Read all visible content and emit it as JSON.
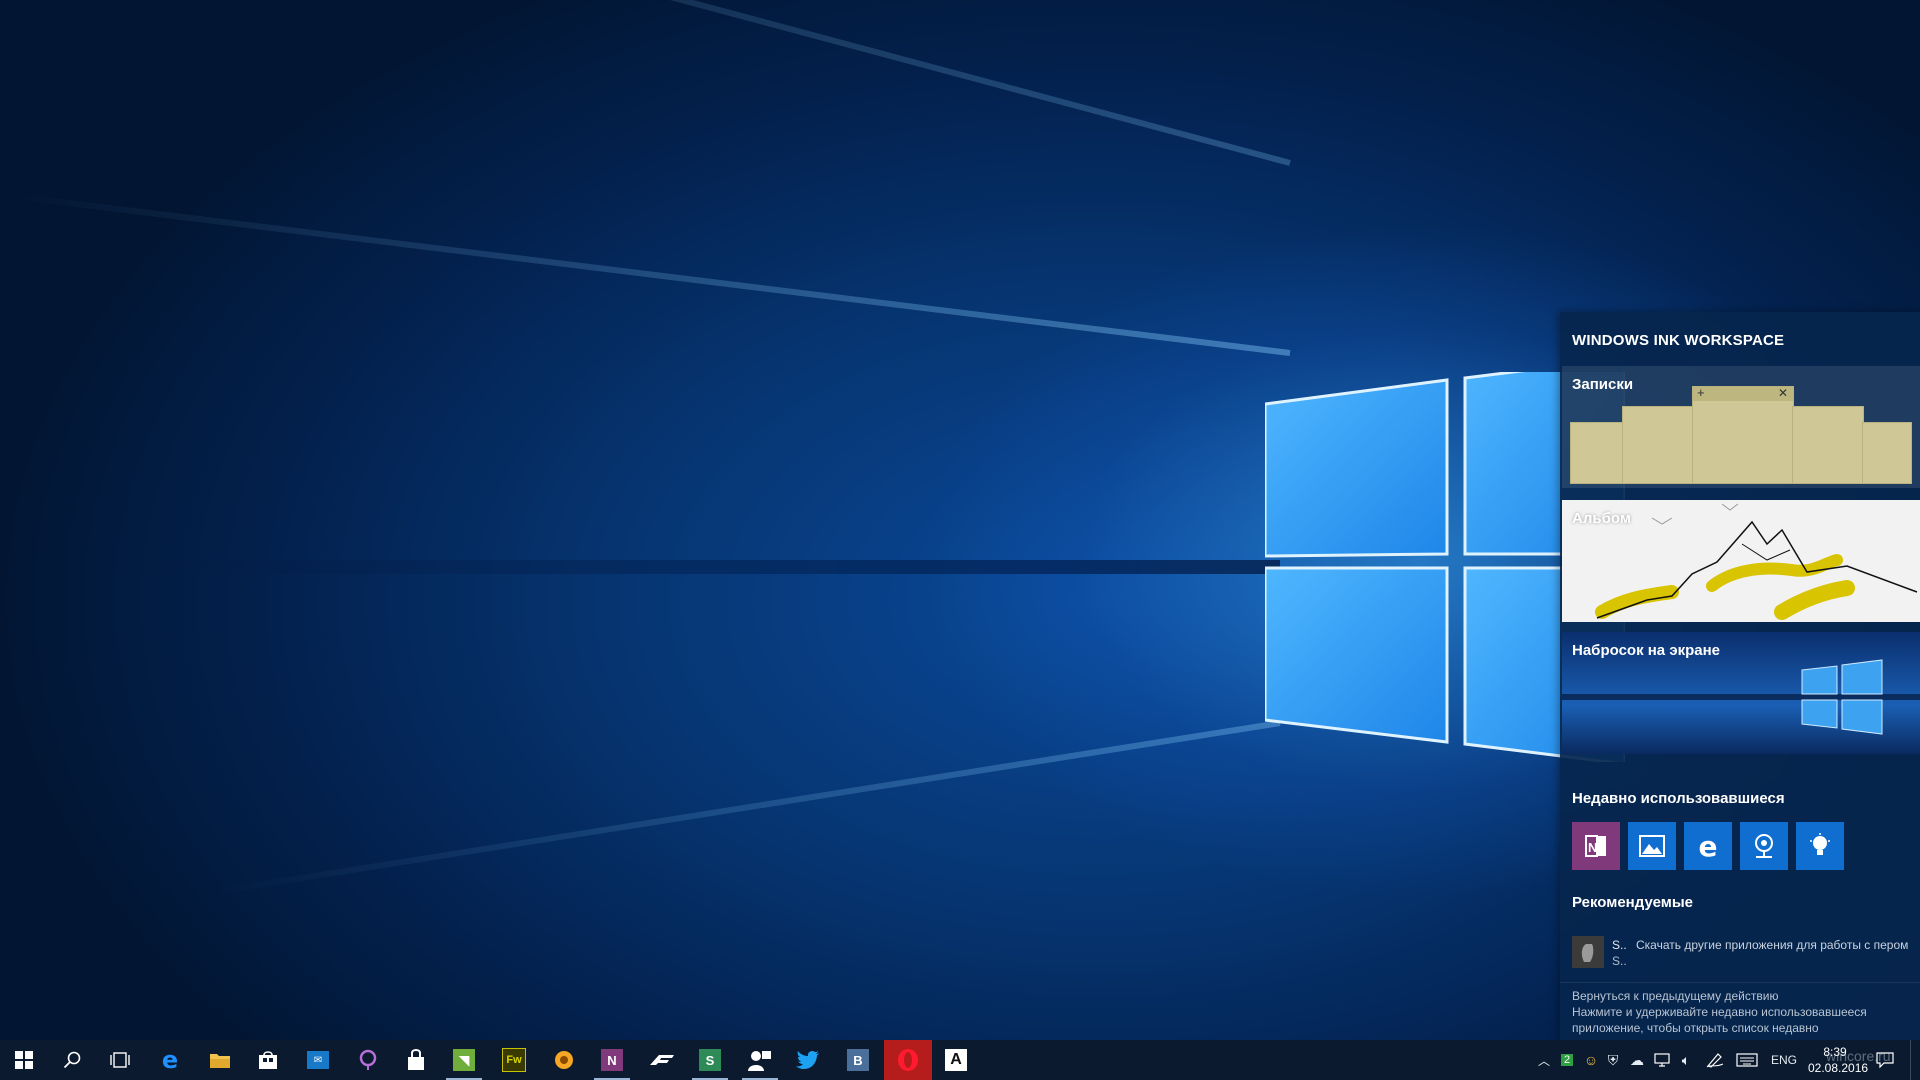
{
  "ink_workspace": {
    "title": "WINDOWS INK WORKSPACE",
    "tiles": [
      {
        "label": "Записки"
      },
      {
        "label": "Альбом"
      },
      {
        "label": "Набросок на экране"
      }
    ],
    "recent_title": "Недавно использовавшиеся",
    "recent_apps": [
      {
        "icon": "onenote-icon",
        "color": "#80397b"
      },
      {
        "icon": "photos-icon",
        "color": "#0f6ecf"
      },
      {
        "icon": "edge-icon",
        "color": "#0f6ecf"
      },
      {
        "icon": "maps-icon",
        "color": "#0f6ecf"
      },
      {
        "icon": "tips-icon",
        "color": "#0f6ecf"
      }
    ],
    "suggested_title": "Рекомендуемые",
    "suggested": {
      "name": "S..",
      "name_line2": "S..",
      "description": "Скачать другие приложения для работы с пером"
    },
    "hint": {
      "line1": "Вернуться к предыдущему действию",
      "line2": "Нажмите и удерживайте недавно использовавшееся",
      "line3": "приложение, чтобы открыть список недавно"
    }
  },
  "taskbar": {
    "buttons": [
      "start-button",
      "search-button",
      "task-view-button",
      "edge-icon",
      "file-explorer-icon",
      "store-icon",
      "outlook-icon",
      "cortana-app-icon",
      "lock-app-icon",
      "feed-reader-icon",
      "fireworks-icon",
      "gear-app-icon",
      "onenote-icon",
      "forza-icon",
      "sway-icon",
      "people-icon",
      "twitter-icon",
      "vk-icon",
      "opera-icon",
      "font-app-icon"
    ],
    "tray": {
      "language": "ENG",
      "time": "8:39",
      "date": "02.08.2016",
      "badge_count": "2"
    }
  },
  "watermark": "wincore.ru"
}
